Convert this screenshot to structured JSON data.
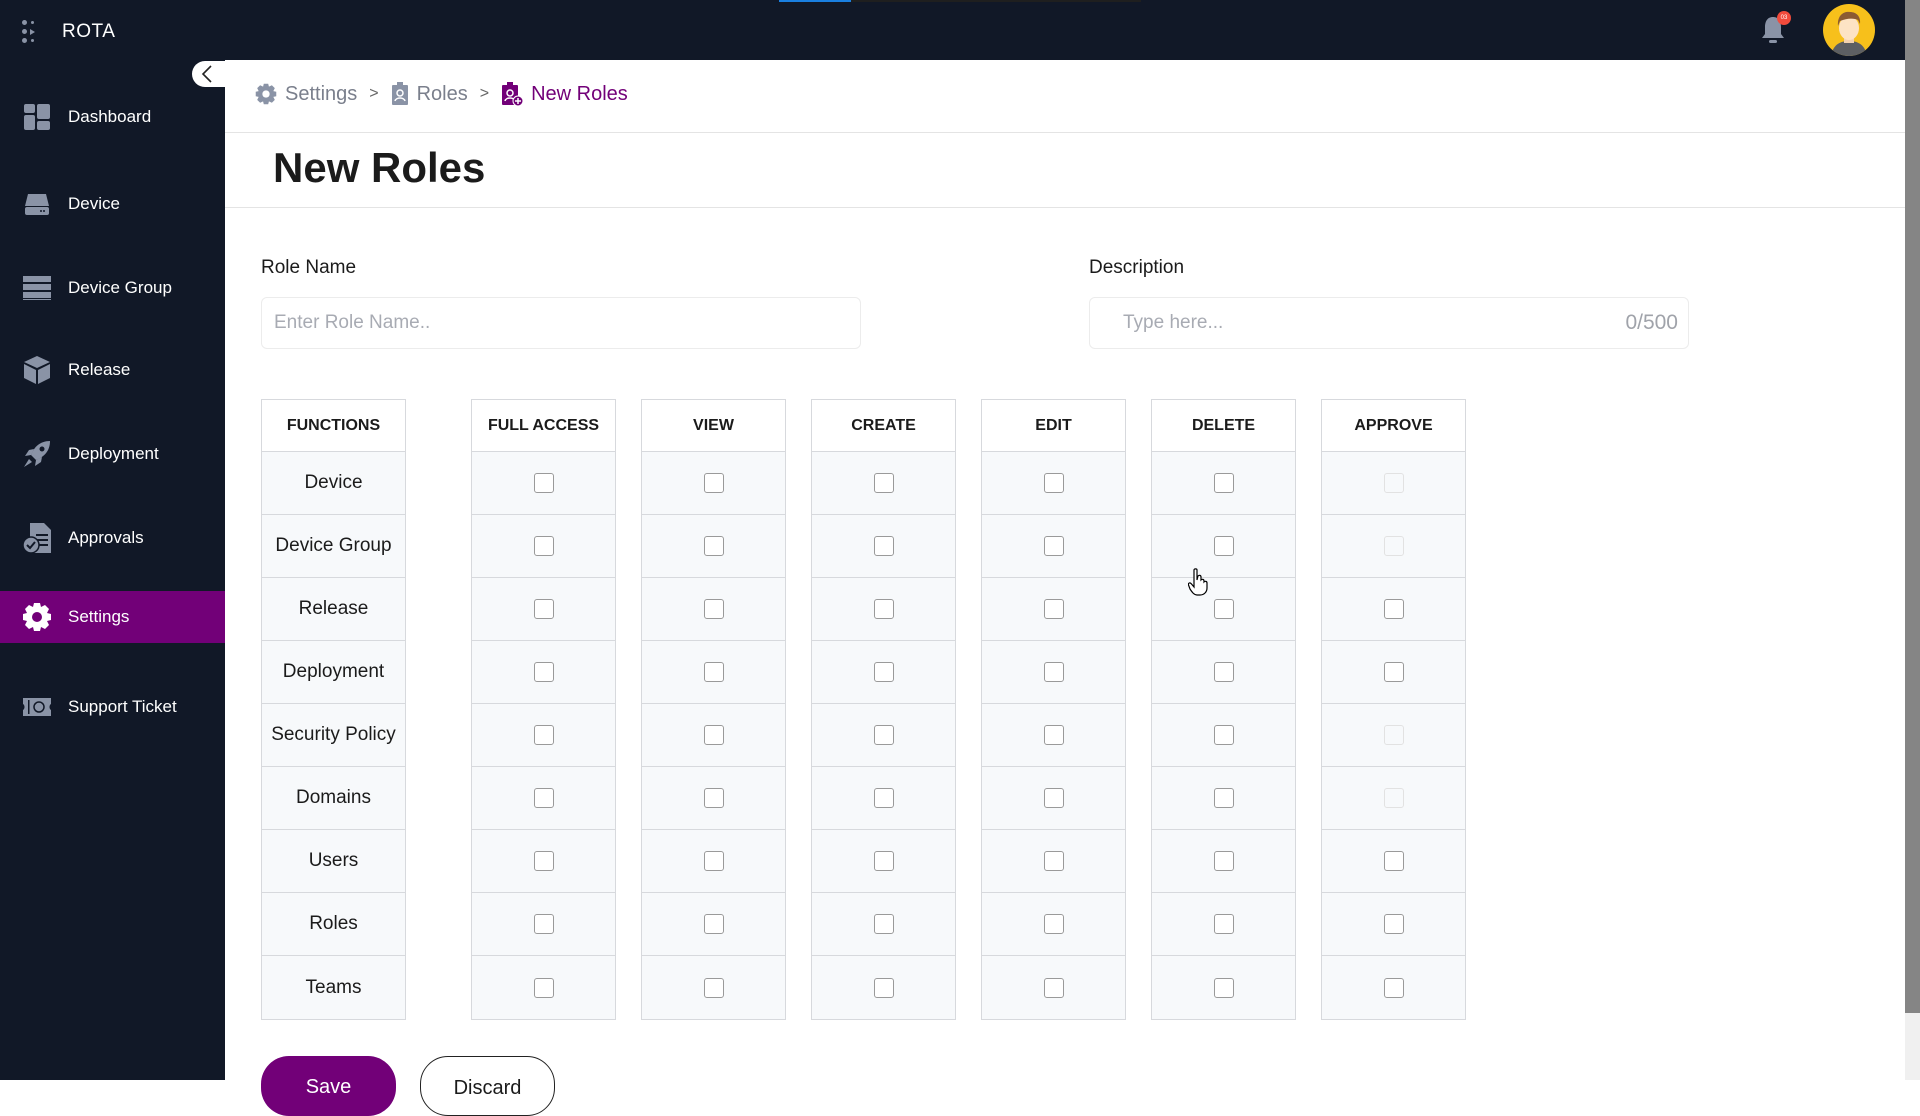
{
  "app": {
    "name": "ROTA"
  },
  "topbar": {
    "loading_progress_percent": 20,
    "notifications_badge": "03",
    "colors": {
      "background": "#111827",
      "badge": "#f24b3c",
      "loading": "#1a7fe0"
    }
  },
  "sidebar": {
    "items": [
      {
        "label": "Dashboard",
        "icon": "dashboard-icon",
        "active": false
      },
      {
        "label": "Device",
        "icon": "hard-drive-icon",
        "active": false
      },
      {
        "label": "Device Group",
        "icon": "server-stack-icon",
        "active": false
      },
      {
        "label": "Release",
        "icon": "box-icon",
        "active": false
      },
      {
        "label": "Deployment",
        "icon": "rocket-icon",
        "active": false
      },
      {
        "label": "Approvals",
        "icon": "document-check-icon",
        "active": false
      },
      {
        "label": "Settings",
        "icon": "gear-icon",
        "active": true
      },
      {
        "label": "Support Ticket",
        "icon": "ticket-icon",
        "active": false
      }
    ],
    "active_color": "#720078"
  },
  "breadcrumb": [
    {
      "label": "Settings",
      "icon": "gear-icon"
    },
    {
      "label": "Roles",
      "icon": "id-badge-icon"
    },
    {
      "label": "New Roles",
      "icon": "id-badge-add-icon"
    }
  ],
  "page": {
    "title": "New Roles"
  },
  "form": {
    "role_name": {
      "label": "Role Name",
      "value": "",
      "placeholder": "Enter Role Name.."
    },
    "description": {
      "label": "Description",
      "value": "",
      "placeholder": "Type here...",
      "counter": "0/500"
    }
  },
  "permissions": {
    "columns": [
      "FUNCTIONS",
      "FULL ACCESS",
      "VIEW",
      "CREATE",
      "EDIT",
      "DELETE",
      "APPROVE"
    ],
    "rows": [
      {
        "function": "Device",
        "checked": [
          false,
          false,
          false,
          false,
          false,
          false
        ],
        "approve_enabled": false
      },
      {
        "function": "Device Group",
        "checked": [
          false,
          false,
          false,
          false,
          false,
          false
        ],
        "approve_enabled": false
      },
      {
        "function": "Release",
        "checked": [
          false,
          false,
          false,
          false,
          false,
          false
        ],
        "approve_enabled": true
      },
      {
        "function": "Deployment",
        "checked": [
          false,
          false,
          false,
          false,
          false,
          false
        ],
        "approve_enabled": true
      },
      {
        "function": "Security Policy",
        "checked": [
          false,
          false,
          false,
          false,
          false,
          false
        ],
        "approve_enabled": false
      },
      {
        "function": "Domains",
        "checked": [
          false,
          false,
          false,
          false,
          false,
          false
        ],
        "approve_enabled": false
      },
      {
        "function": "Users",
        "checked": [
          false,
          false,
          false,
          false,
          false,
          false
        ],
        "approve_enabled": true
      },
      {
        "function": "Roles",
        "checked": [
          false,
          false,
          false,
          false,
          false,
          false
        ],
        "approve_enabled": true
      },
      {
        "function": "Teams",
        "checked": [
          false,
          false,
          false,
          false,
          false,
          false
        ],
        "approve_enabled": true
      }
    ]
  },
  "actions": {
    "save_label": "Save",
    "discard_label": "Discard"
  }
}
